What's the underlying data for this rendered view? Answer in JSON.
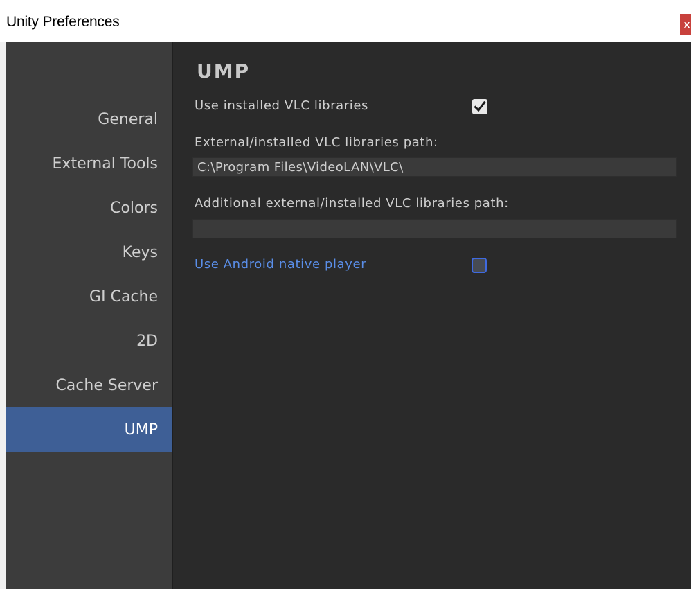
{
  "window": {
    "title": "Unity Preferences",
    "close_glyph": "x"
  },
  "sidebar": {
    "items": [
      {
        "label": "General",
        "selected": false
      },
      {
        "label": "External Tools",
        "selected": false
      },
      {
        "label": "Colors",
        "selected": false
      },
      {
        "label": "Keys",
        "selected": false
      },
      {
        "label": "GI Cache",
        "selected": false
      },
      {
        "label": "2D",
        "selected": false
      },
      {
        "label": "Cache Server",
        "selected": false
      },
      {
        "label": "UMP",
        "selected": true
      }
    ]
  },
  "content": {
    "heading": "UMP",
    "use_installed_vlc": {
      "label": "Use installed VLC libraries",
      "checked": true
    },
    "external_path": {
      "label": "External/installed VLC libraries path:",
      "value": "C:\\Program Files\\VideoLAN\\VLC\\"
    },
    "additional_path": {
      "label": "Additional external/installed VLC libraries path:",
      "value": ""
    },
    "android_native": {
      "label": "Use Android native player",
      "checked": false
    }
  },
  "colors": {
    "selection": "#3e5f96",
    "link": "#5a8ee8",
    "close": "#c8413c"
  }
}
